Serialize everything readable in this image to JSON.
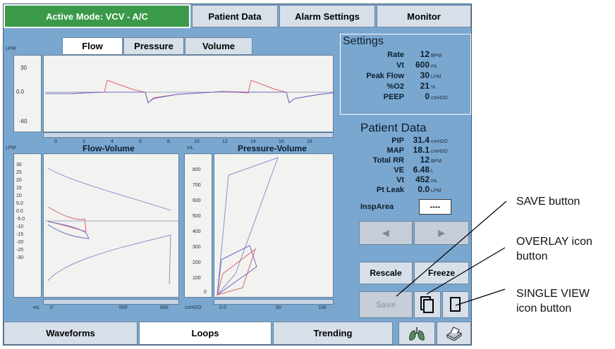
{
  "header": {
    "mode_label": "Active Mode: VCV - A/C",
    "tabs": [
      "Patient Data",
      "Alarm Settings",
      "Monitor"
    ]
  },
  "waveform": {
    "unit": "LPM",
    "tabs": [
      "Flow",
      "Pressure",
      "Volume"
    ],
    "y_ticks": [
      "30",
      "0.0",
      "-60"
    ],
    "x_ticks": [
      "0",
      "2",
      "4",
      "6",
      "8",
      "10",
      "12",
      "14",
      "16",
      "18"
    ]
  },
  "flow_volume": {
    "title": "Flow-Volume",
    "y_unit": "LPM",
    "x_unit": "mL",
    "y_ticks": [
      "30",
      "25",
      "20",
      "15",
      "10",
      "5.0",
      "0.0",
      "-5.0",
      "-10",
      "-15",
      "-20",
      "-25",
      "-30"
    ],
    "x_ticks": [
      "0",
      "500",
      "800"
    ]
  },
  "pressure_volume": {
    "title": "Pressure-Volume",
    "y_unit": "mL",
    "x_unit": "cmH2O",
    "y_ticks": [
      "800",
      "700",
      "600",
      "500",
      "400",
      "300",
      "200",
      "100",
      "0"
    ],
    "x_ticks": [
      "0.0",
      "50",
      "100"
    ]
  },
  "settings": {
    "title": "Settings",
    "rows": [
      {
        "name": "Rate",
        "value": "12",
        "unit": "BPM"
      },
      {
        "name": "Vt",
        "value": "600",
        "unit": "mL"
      },
      {
        "name": "Peak Flow",
        "value": "30",
        "unit": "LPM"
      },
      {
        "name": "%O2",
        "value": "21",
        "unit": "%"
      },
      {
        "name": "PEEP",
        "value": "0",
        "unit": "cmH2O"
      }
    ]
  },
  "patient_data": {
    "title": "Patient Data",
    "rows": [
      {
        "name": "PIP",
        "value": "31.4",
        "unit": "cmH2O"
      },
      {
        "name": "MAP",
        "value": "18.1",
        "unit": "cmH2O"
      },
      {
        "name": "Total RR",
        "value": "12",
        "unit": "BPM"
      },
      {
        "name": "VE",
        "value": "6.48",
        "unit": "L"
      },
      {
        "name": "Vt",
        "value": "452",
        "unit": "mL"
      },
      {
        "name": "Pt Leak",
        "value": "0.0",
        "unit": "LPM"
      }
    ],
    "insp_area_label": "InspArea",
    "insp_area_value": "----"
  },
  "controls": {
    "rescale": "Rescale",
    "freeze": "Freeze",
    "save": "Save"
  },
  "bottom_tabs": [
    "Waveforms",
    "Loops",
    "Trending"
  ],
  "callouts": {
    "save": "SAVE button",
    "overlay": "OVERLAY icon button",
    "single": "SINGLE VIEW icon button"
  },
  "colors": {
    "screen_bg": "#7aa7cf",
    "mode_green": "#3a9a4a",
    "trace_red": "#e06070",
    "trace_blue": "#6a6ac8",
    "button_bg": "#d7dfe9"
  }
}
